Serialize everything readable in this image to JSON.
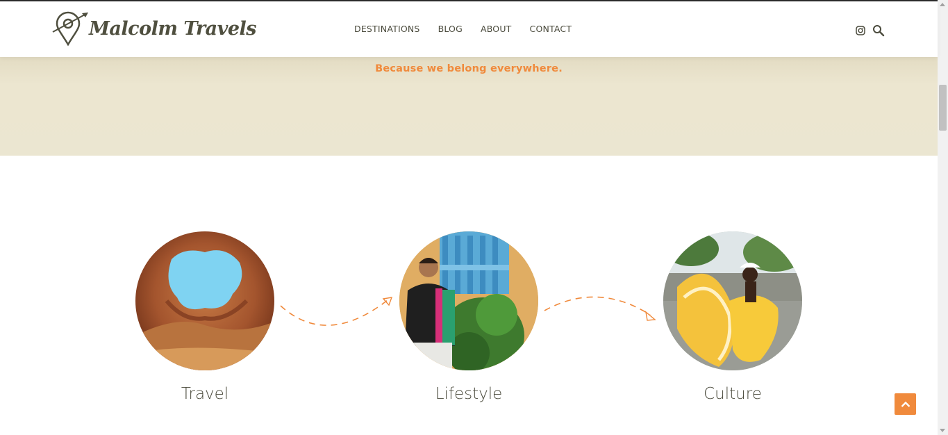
{
  "header": {
    "logo_text": "Malcolm Travels",
    "nav": [
      "DESTINATIONS",
      "BLOG",
      "ABOUT",
      "CONTACT"
    ],
    "icons": [
      "instagram-icon",
      "search-icon"
    ]
  },
  "banner": {
    "tagline": "Because we belong everywhere."
  },
  "categories": [
    {
      "label": "Travel",
      "image": "cave-opening-sky"
    },
    {
      "label": "Lifestyle",
      "image": "man-by-blue-shutter"
    },
    {
      "label": "Culture",
      "image": "dancers-in-yellow-dresses"
    }
  ],
  "colors": {
    "accent": "#f08a3c",
    "banner": "#ebe6d1",
    "text": "#4a4a3c"
  }
}
